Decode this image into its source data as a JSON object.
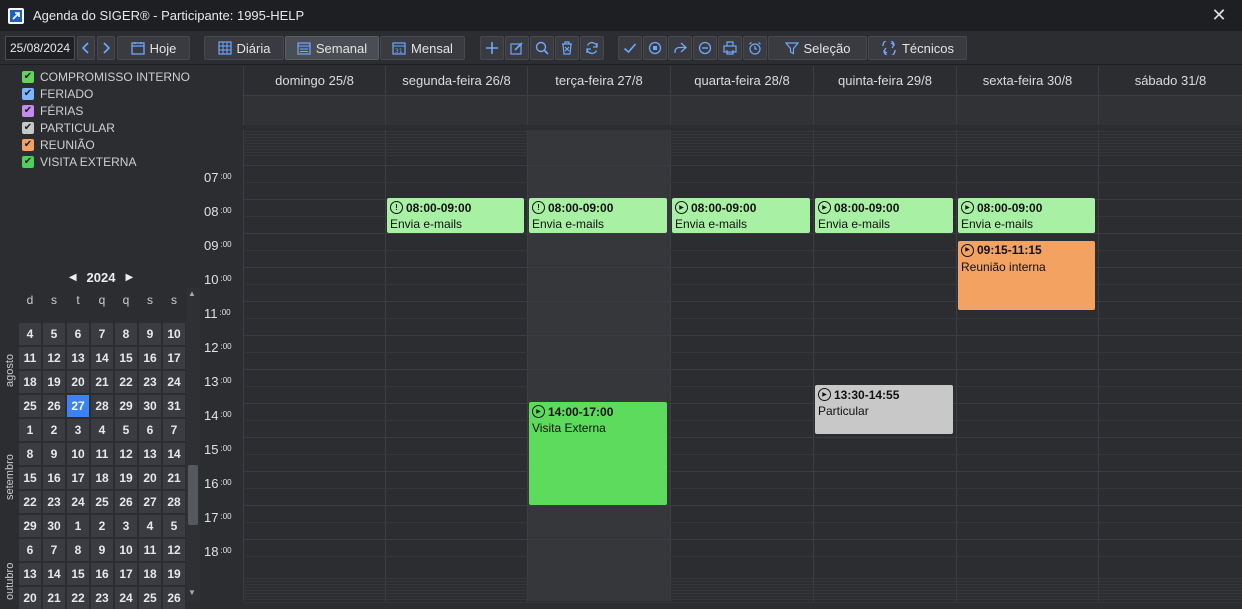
{
  "window": {
    "title": "Agenda do SIGER® - Participante: 1995-HELP"
  },
  "toolbar": {
    "date_value": "25/08/2024",
    "today_label": "Hoje",
    "view_daily": "Diária",
    "view_weekly": "Semanal",
    "view_monthly": "Mensal",
    "selection_label": "Seleção",
    "technicians_label": "Técnicos"
  },
  "legend": [
    {
      "label": "COMPROMISSO INTERNO",
      "color": "#63d35e"
    },
    {
      "label": "FERIADO",
      "color": "#7ab7ff"
    },
    {
      "label": "FÉRIAS",
      "color": "#c58cf0"
    },
    {
      "label": "PARTICULAR",
      "color": "#c8c8c8"
    },
    {
      "label": "REUNIÃO",
      "color": "#f4a261"
    },
    {
      "label": "VISITA EXTERNA",
      "color": "#4cd15a"
    }
  ],
  "mini_calendar": {
    "year": "2024",
    "weekdays": [
      "d",
      "s",
      "t",
      "q",
      "q",
      "s",
      "s"
    ],
    "months": [
      "agosto",
      "setembro",
      "outubro"
    ],
    "rows": [
      [
        "4",
        "5",
        "6",
        "7",
        "8",
        "9",
        "10"
      ],
      [
        "11",
        "12",
        "13",
        "14",
        "15",
        "16",
        "17"
      ],
      [
        "18",
        "19",
        "20",
        "21",
        "22",
        "23",
        "24"
      ],
      [
        "25",
        "26",
        "27",
        "28",
        "29",
        "30",
        "31"
      ],
      [
        "1",
        "2",
        "3",
        "4",
        "5",
        "6",
        "7"
      ],
      [
        "8",
        "9",
        "10",
        "11",
        "12",
        "13",
        "14"
      ],
      [
        "15",
        "16",
        "17",
        "18",
        "19",
        "20",
        "21"
      ],
      [
        "22",
        "23",
        "24",
        "25",
        "26",
        "27",
        "28"
      ],
      [
        "29",
        "30",
        "1",
        "2",
        "3",
        "4",
        "5"
      ],
      [
        "6",
        "7",
        "8",
        "9",
        "10",
        "11",
        "12"
      ],
      [
        "13",
        "14",
        "15",
        "16",
        "17",
        "18",
        "19"
      ],
      [
        "20",
        "21",
        "22",
        "23",
        "24",
        "25",
        "26"
      ]
    ],
    "selected": "27"
  },
  "week": {
    "days": [
      "domingo 25/8",
      "segunda-feira 26/8",
      "terça-feira 27/8",
      "quarta-feira 28/8",
      "quinta-feira 29/8",
      "sexta-feira 30/8",
      "sábado 31/8"
    ],
    "hours": [
      "07",
      "08",
      "09",
      "10",
      "11",
      "12",
      "13",
      "14",
      "15",
      "16",
      "17",
      "18"
    ],
    "minute_suffix": ":00"
  },
  "events": [
    {
      "day": 1,
      "time": "08:00-09:00",
      "subject": "Envia e-mails",
      "color": "#a8f0a4",
      "icon": "alert-icon"
    },
    {
      "day": 2,
      "time": "08:00-09:00",
      "subject": "Envia e-mails",
      "color": "#a8f0a4",
      "icon": "alert-icon"
    },
    {
      "day": 3,
      "time": "08:00-09:00",
      "subject": "Envia e-mails",
      "color": "#a8f0a4",
      "icon": "play-icon"
    },
    {
      "day": 4,
      "time": "08:00-09:00",
      "subject": "Envia e-mails",
      "color": "#a8f0a4",
      "icon": "play-icon"
    },
    {
      "day": 5,
      "time": "08:00-09:00",
      "subject": "Envia e-mails",
      "color": "#a8f0a4",
      "icon": "play-icon"
    },
    {
      "day": 5,
      "time": "09:15-11:15",
      "subject": "Reunião interna",
      "color": "#f4a261",
      "icon": "play-icon"
    },
    {
      "day": 4,
      "time": "13:30-14:55",
      "subject": "Particular",
      "color": "#c8c8c8",
      "icon": "play-icon"
    },
    {
      "day": 2,
      "time": "14:00-17:00",
      "subject": "Visita Externa",
      "color": "#5cdb5c",
      "icon": "play-icon"
    }
  ]
}
